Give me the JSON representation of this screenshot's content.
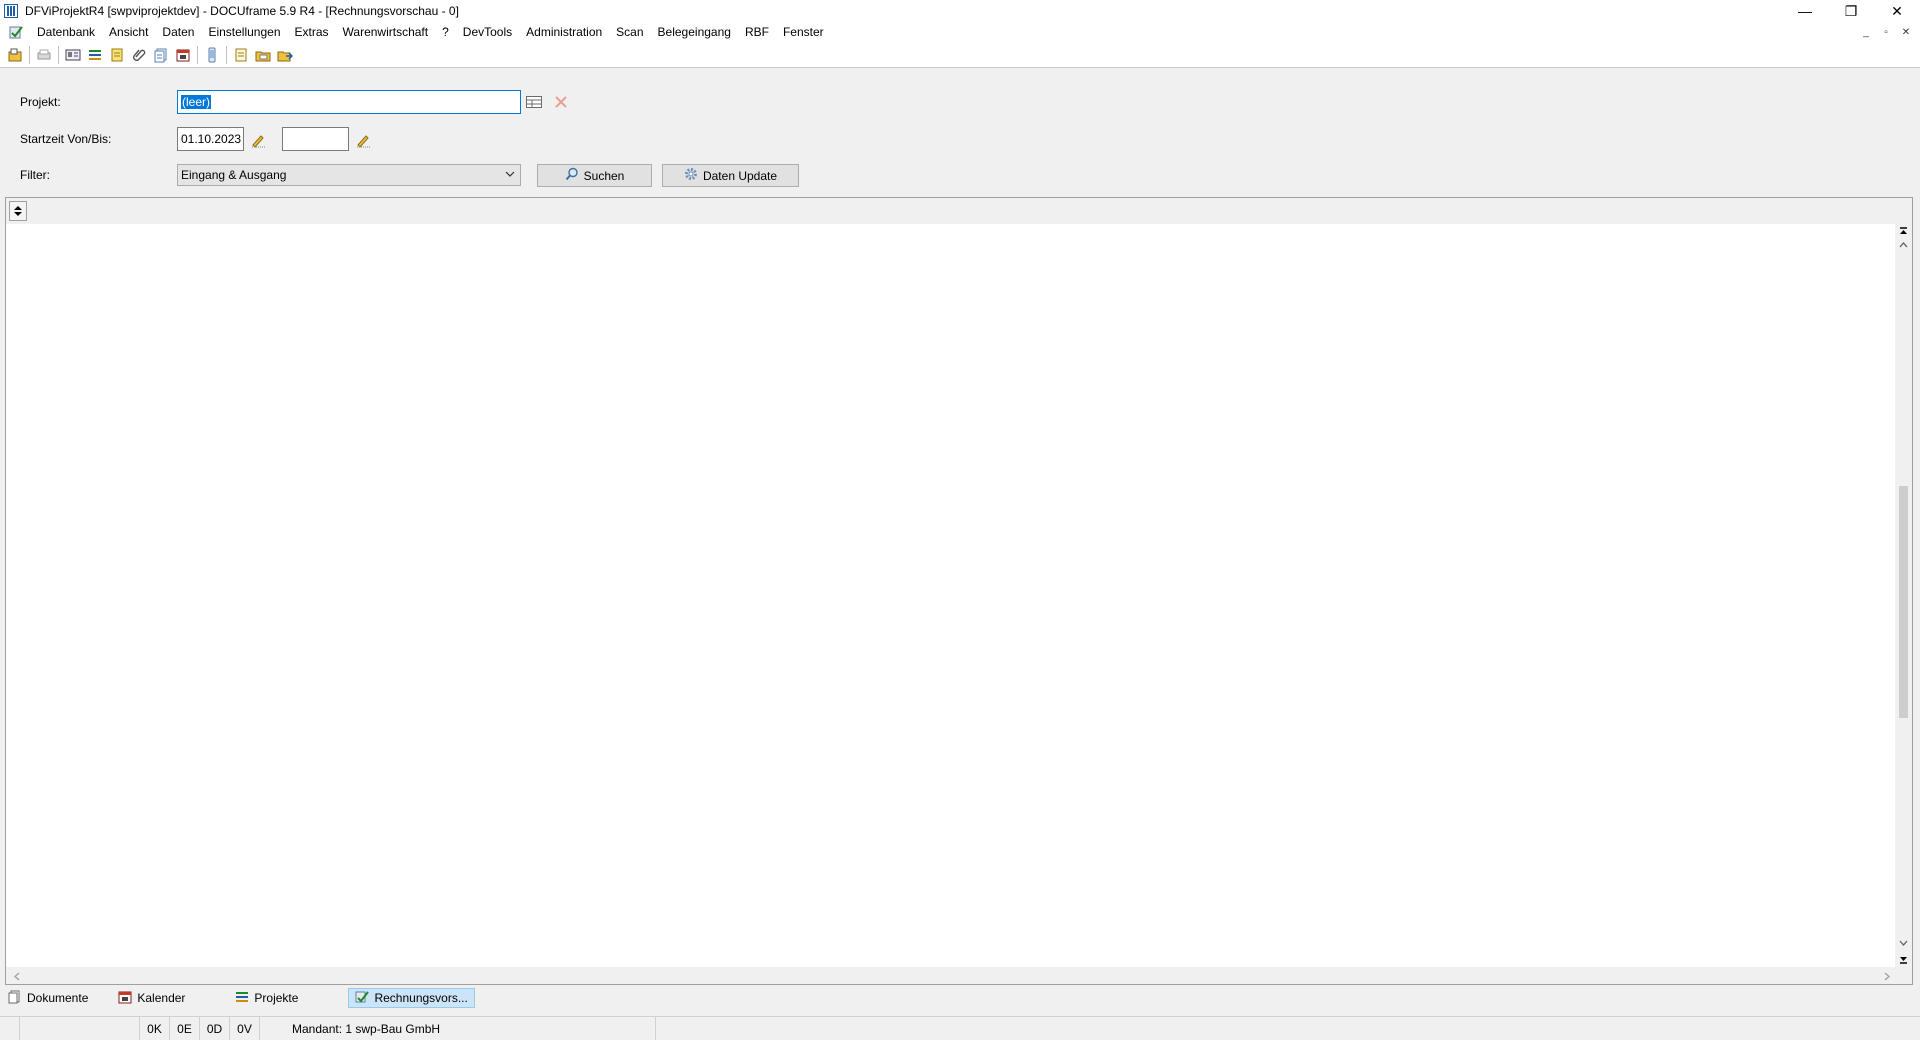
{
  "window": {
    "title": "DFViProjektR4 [swpviprojektdev] - DOCUframe 5.9 R4 - [Rechnungsvorschau - 0]",
    "minimize": "—",
    "restore": "❐",
    "close": "✕"
  },
  "menu": {
    "items": [
      "Datenbank",
      "Ansicht",
      "Daten",
      "Einstellungen",
      "Extras",
      "Warenwirtschaft",
      "?",
      "DevTools",
      "Administration",
      "Scan",
      "Belegeingang",
      "RBF",
      "Fenster"
    ],
    "mdi_minimize": "_",
    "mdi_restore": "▫",
    "mdi_close": "✕"
  },
  "form": {
    "projekt_label": "Projekt:",
    "projekt_value": "(leer)",
    "startzeit_label": "Startzeit Von/Bis:",
    "start_from": "01.10.2023",
    "start_to": "",
    "filter_label": "Filter:",
    "filter_value": "Eingang & Ausgang",
    "search_button": "Suchen",
    "update_button": "Daten Update"
  },
  "tabs": [
    "Dokumente",
    "Kalender",
    "Projekte",
    "Rechnungsvors..."
  ],
  "active_tab": "Rechnungsvors...",
  "status": {
    "k": "0K",
    "e": "0E",
    "d": "0D",
    "v": "0V",
    "mandant": "Mandant: 1 swp-Bau GmbH"
  }
}
